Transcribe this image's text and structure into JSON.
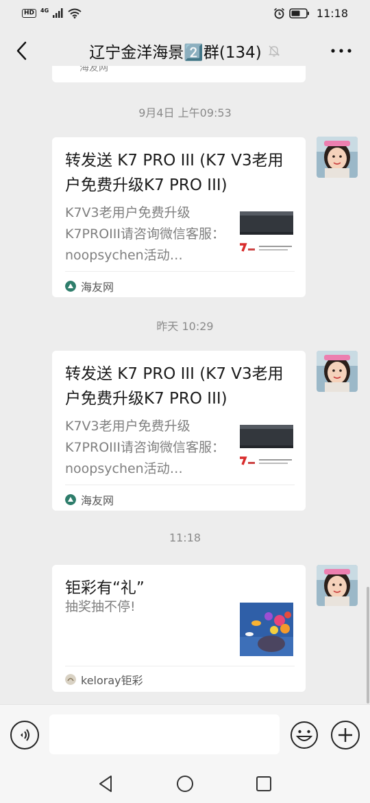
{
  "status_bar": {
    "hd_label": "HD",
    "network_label": "4G",
    "time": "11:18"
  },
  "header": {
    "title": "辽宁金洋海景2️⃣群(134)",
    "back_icon": "chevron-left-icon",
    "mute_icon": "bell-off-icon",
    "more_icon": "more-icon"
  },
  "chat": {
    "partial_card_text": "海友网",
    "messages": [
      {
        "timestamp": "9月4日 上午09:53",
        "title": "转发送 K7 PRO III (K7 V3老用户免费升级K7 PRO III)",
        "desc": "K7V3老用户免费升级K7PROIII请咨询微信客服：noopsychen活动…",
        "source": "海友网"
      },
      {
        "timestamp": "昨天 10:29",
        "title": "转发送 K7 PRO III (K7 V3老用户免费升级K7 PRO III)",
        "desc": "K7V3老用户免费升级K7PROIII请咨询微信客服：noopsychen活动…",
        "source": "海友网"
      },
      {
        "timestamp": "11:18",
        "title": "钜彩有“礼”",
        "desc": "抽奖抽不停!",
        "source": "keloray钜彩"
      }
    ]
  },
  "input_bar": {
    "placeholder": ""
  },
  "colors": {
    "background": "#ededed",
    "card": "#ffffff",
    "timestamp": "#8a8a8a",
    "desc": "#7f7f7f"
  }
}
